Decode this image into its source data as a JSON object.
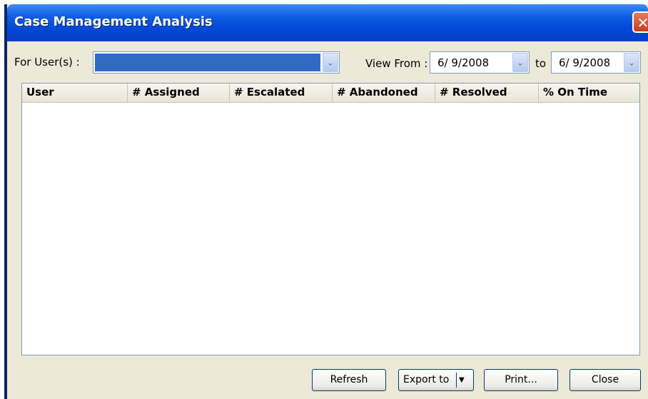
{
  "window": {
    "title": "Case Management Analysis",
    "close_glyph": "✕"
  },
  "filters": {
    "for_users_label": "For User(s) :",
    "view_from_label": "View From :",
    "from_date": "6/ 9/2008",
    "to_label": "to",
    "to_date": "6/ 9/2008",
    "dropdown_glyph": "⌄"
  },
  "table": {
    "columns": [
      "User",
      "# Assigned",
      "# Escalated",
      "# Abandoned",
      "# Resolved",
      "% On Time"
    ],
    "rows": []
  },
  "buttons": {
    "refresh": "Refresh",
    "export_to": "Export to",
    "export_arrow": "▼",
    "print": "Print...",
    "close": "Close"
  },
  "colors": {
    "titlebar": "#0047D6",
    "window_bg": "#ECE9D8",
    "selection": "#316AC5"
  },
  "icons": {
    "close": "close-icon",
    "dropdown": "chevron-down-icon"
  }
}
